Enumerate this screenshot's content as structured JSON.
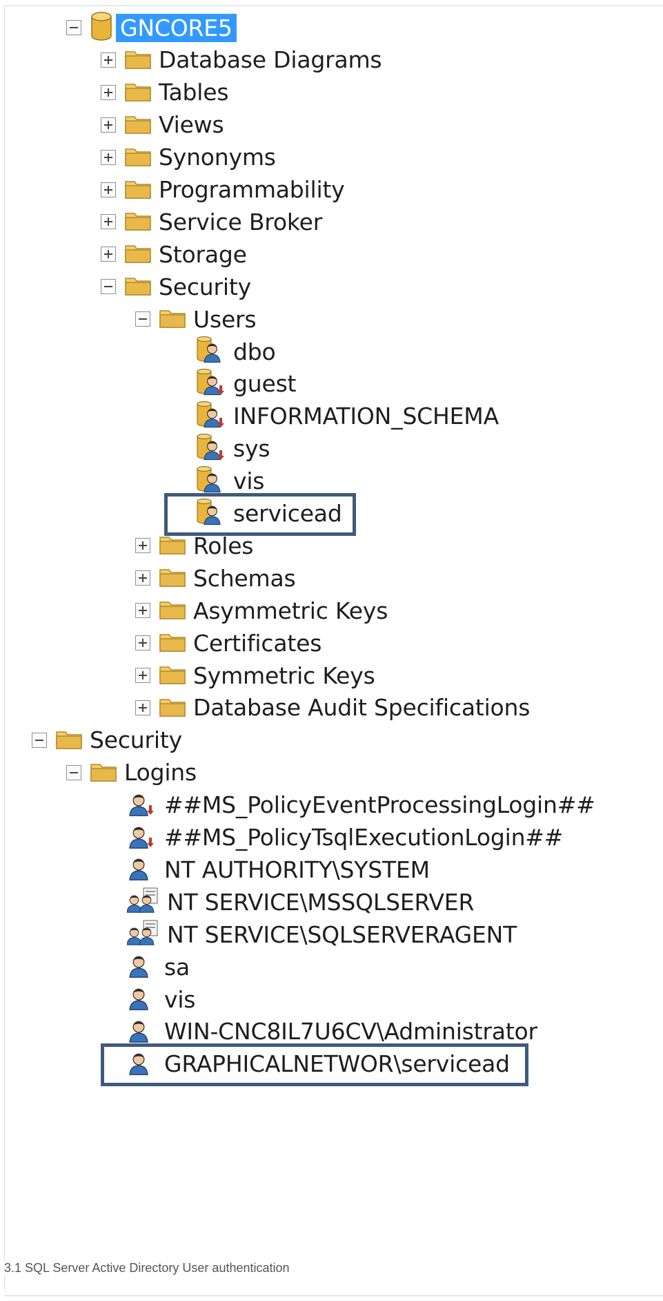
{
  "tree": {
    "database": {
      "label": "GNCORE5",
      "icon": "database-icon",
      "selected": true
    },
    "database_children": [
      {
        "label": "Database Diagrams",
        "icon": "folder-icon",
        "expander": "plus"
      },
      {
        "label": "Tables",
        "icon": "folder-icon",
        "expander": "plus"
      },
      {
        "label": "Views",
        "icon": "folder-icon",
        "expander": "plus"
      },
      {
        "label": "Synonyms",
        "icon": "folder-icon",
        "expander": "plus"
      },
      {
        "label": "Programmability",
        "icon": "folder-icon",
        "expander": "plus"
      },
      {
        "label": "Service Broker",
        "icon": "folder-icon",
        "expander": "plus"
      },
      {
        "label": "Storage",
        "icon": "folder-icon",
        "expander": "plus"
      },
      {
        "label": "Security",
        "icon": "folder-icon",
        "expander": "minus"
      }
    ],
    "users_folder": {
      "label": "Users",
      "icon": "folder-icon",
      "expander": "minus"
    },
    "users": [
      {
        "label": "dbo",
        "icon": "db-user-icon"
      },
      {
        "label": "guest",
        "icon": "db-user-disabled-icon"
      },
      {
        "label": "INFORMATION_SCHEMA",
        "icon": "db-user-disabled-icon"
      },
      {
        "label": "sys",
        "icon": "db-user-disabled-icon"
      },
      {
        "label": "vis",
        "icon": "db-user-icon"
      },
      {
        "label": "servicead",
        "icon": "db-user-icon",
        "highlighted": true
      }
    ],
    "security_children": [
      {
        "label": "Roles",
        "icon": "folder-icon",
        "expander": "plus"
      },
      {
        "label": "Schemas",
        "icon": "folder-icon",
        "expander": "plus"
      },
      {
        "label": "Asymmetric Keys",
        "icon": "folder-icon",
        "expander": "plus"
      },
      {
        "label": "Certificates",
        "icon": "folder-icon",
        "expander": "plus"
      },
      {
        "label": "Symmetric Keys",
        "icon": "folder-icon",
        "expander": "plus"
      },
      {
        "label": "Database Audit Specifications",
        "icon": "folder-icon",
        "expander": "plus"
      }
    ],
    "server_security": {
      "label": "Security",
      "icon": "folder-icon",
      "expander": "minus"
    },
    "logins_folder": {
      "label": "Logins",
      "icon": "folder-icon",
      "expander": "minus"
    },
    "logins": [
      {
        "label": "##MS_PolicyEventProcessingLogin##",
        "icon": "login-disabled-icon"
      },
      {
        "label": "##MS_PolicyTsqlExecutionLogin##",
        "icon": "login-disabled-icon"
      },
      {
        "label": "NT AUTHORITY\\SYSTEM",
        "icon": "login-icon"
      },
      {
        "label": "NT SERVICE\\MSSQLSERVER",
        "icon": "group-login-icon"
      },
      {
        "label": "NT SERVICE\\SQLSERVERAGENT",
        "icon": "group-login-icon"
      },
      {
        "label": "sa",
        "icon": "login-icon"
      },
      {
        "label": "vis",
        "icon": "login-icon"
      },
      {
        "label": "WIN-CNC8IL7U6CV\\Administrator",
        "icon": "login-icon"
      },
      {
        "label": "GRAPHICALNETWOR\\servicead",
        "icon": "login-icon",
        "highlighted": true
      }
    ]
  },
  "caption": "3.1 SQL Server Active Directory User authentication",
  "colors": {
    "selection": "#3399ff",
    "highlight_border": "#3e5a7c",
    "folder": "#e8b84a",
    "user_blue": "#3a73b8",
    "disabled_arrow": "#c0392b"
  }
}
